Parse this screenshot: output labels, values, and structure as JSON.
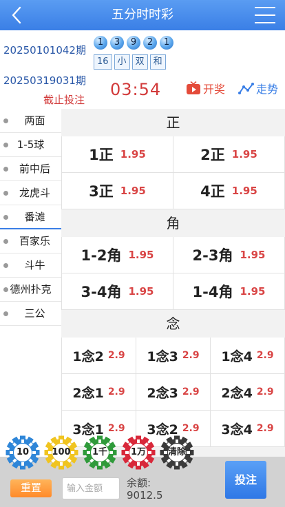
{
  "header": {
    "title": "五分时时彩"
  },
  "draw": {
    "previous_issue": "20250101042期",
    "balls": [
      "1",
      "3",
      "9",
      "2",
      "1"
    ],
    "tags": [
      "16",
      "小",
      "双",
      "和"
    ],
    "current_issue": "20250319031期",
    "deadline_label": "截止投注",
    "countdown": "03:54",
    "open_label": "开奖",
    "trend_label": "走势"
  },
  "sidebar": {
    "items": [
      {
        "label": "两面",
        "active": false
      },
      {
        "label": "1-5球",
        "active": false
      },
      {
        "label": "前中后",
        "active": false
      },
      {
        "label": "龙虎斗",
        "active": false
      },
      {
        "label": "番滩",
        "active": true
      },
      {
        "label": "百家乐",
        "active": false
      },
      {
        "label": "斗牛",
        "active": false
      },
      {
        "label": "德州扑克",
        "active": false
      },
      {
        "label": "三公",
        "active": false
      }
    ]
  },
  "sections": [
    {
      "title": "正",
      "cols": 2,
      "cells": [
        {
          "name": "1正",
          "odds": "1.95"
        },
        {
          "name": "2正",
          "odds": "1.95"
        },
        {
          "name": "3正",
          "odds": "1.95"
        },
        {
          "name": "4正",
          "odds": "1.95"
        }
      ]
    },
    {
      "title": "角",
      "cols": 2,
      "cells": [
        {
          "name": "1-2角",
          "odds": "1.95"
        },
        {
          "name": "2-3角",
          "odds": "1.95"
        },
        {
          "name": "3-4角",
          "odds": "1.95"
        },
        {
          "name": "1-4角",
          "odds": "1.95"
        }
      ]
    },
    {
      "title": "念",
      "cols": 3,
      "cells": [
        {
          "name": "1念2",
          "odds": "2.9"
        },
        {
          "name": "1念3",
          "odds": "2.9"
        },
        {
          "name": "1念4",
          "odds": "2.9"
        },
        {
          "name": "2念1",
          "odds": "2.9"
        },
        {
          "name": "2念3",
          "odds": "2.9"
        },
        {
          "name": "2念4",
          "odds": "2.9"
        },
        {
          "name": "3念1",
          "odds": "2.9"
        },
        {
          "name": "3念2",
          "odds": "2.9"
        },
        {
          "name": "3念4",
          "odds": "2.9"
        }
      ]
    }
  ],
  "chips": [
    {
      "label": "10",
      "color": "#2f86d8"
    },
    {
      "label": "100",
      "color": "#f0c420"
    },
    {
      "label": "1千",
      "color": "#2f9a3a"
    },
    {
      "label": "1万",
      "color": "#d8283a"
    },
    {
      "label": "清除",
      "color": "#3a3a3a"
    }
  ],
  "footer": {
    "reset_label": "重置",
    "amount_placeholder": "输入金额",
    "balance_label": "余额:",
    "balance_value": "9012.5",
    "bet_label": "投注"
  }
}
